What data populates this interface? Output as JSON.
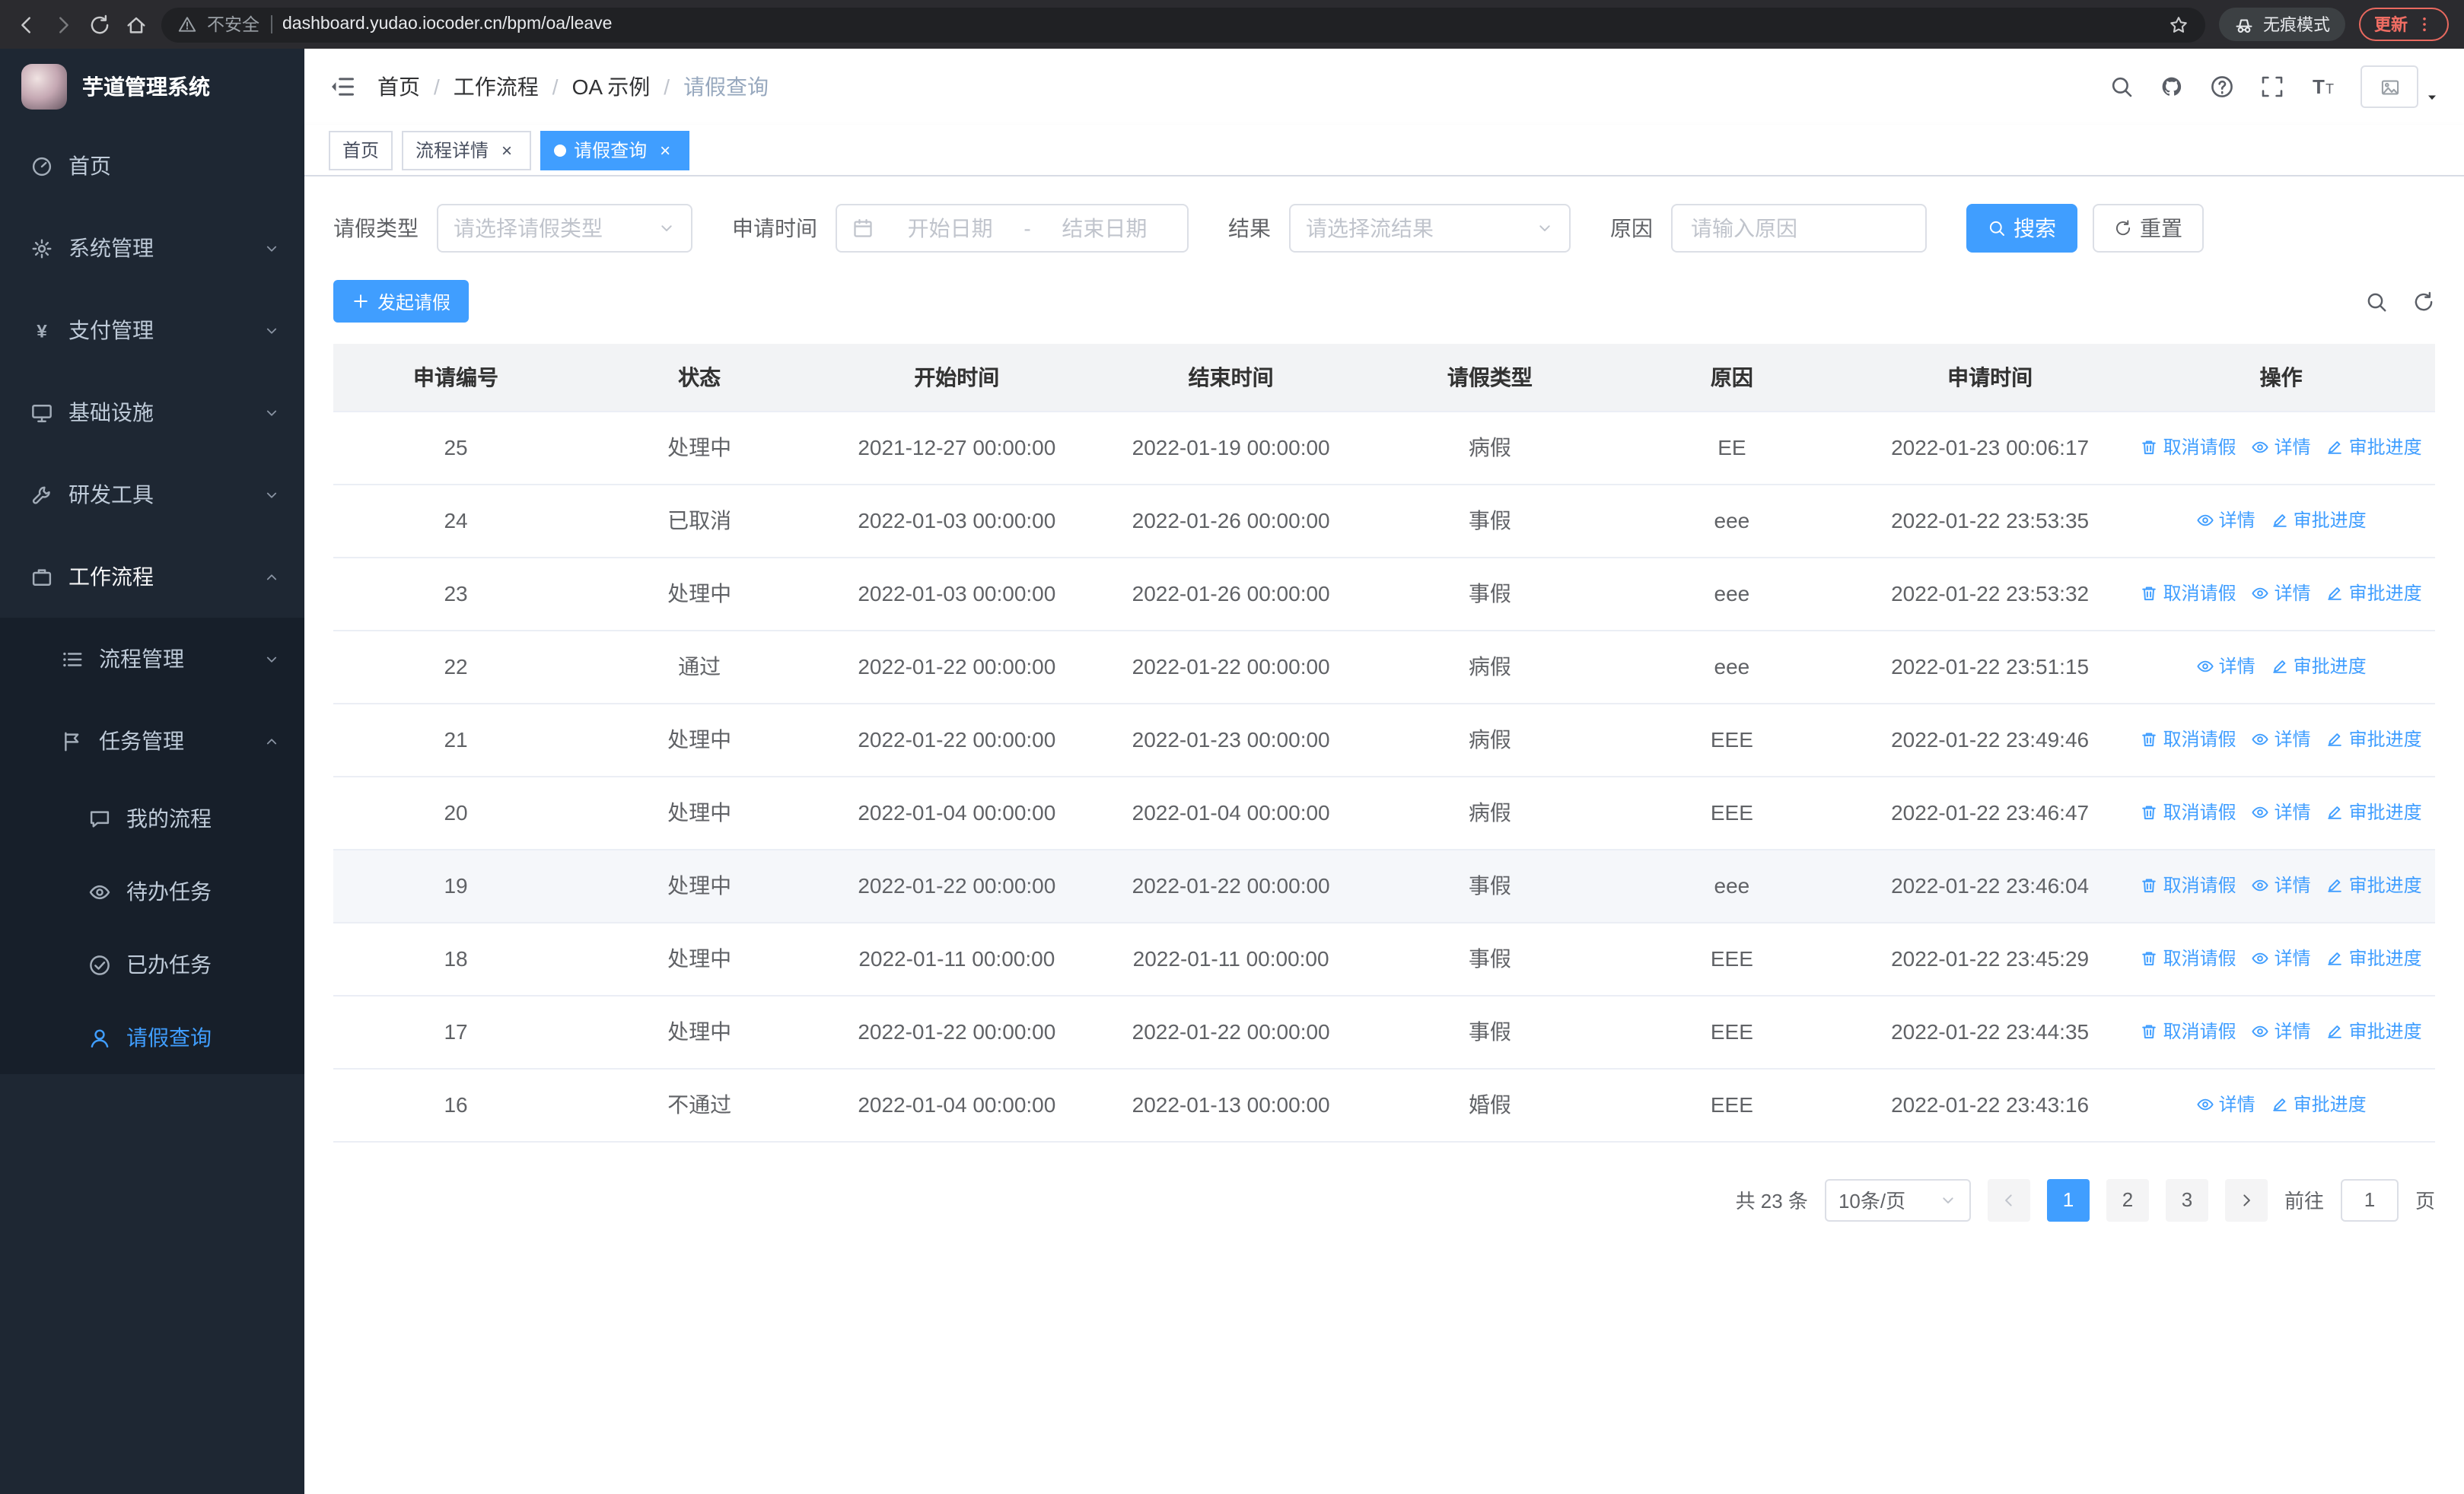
{
  "colors": {
    "primary": "#409eff",
    "sidebar_bg": "#1e2733",
    "sidebar_submenu_bg": "#171f2a",
    "active_tab_bg": "#409eff"
  },
  "browser": {
    "security_label": "不安全",
    "url": "dashboard.yudao.iocoder.cn/bpm/oa/leave",
    "incognito_label": "无痕模式",
    "update_label": "更新"
  },
  "sidebar": {
    "title": "芋道管理系统",
    "menu": [
      {
        "name": "home",
        "label": "首页",
        "icon": "dashboard-icon"
      },
      {
        "name": "system-management",
        "label": "系统管理",
        "icon": "gear-icon",
        "expandable": true
      },
      {
        "name": "payment-management",
        "label": "支付管理",
        "icon": "yen-icon",
        "expandable": true
      },
      {
        "name": "infrastructure",
        "label": "基础设施",
        "icon": "monitor-icon",
        "expandable": true
      },
      {
        "name": "dev-tools",
        "label": "研发工具",
        "icon": "tools-icon",
        "expandable": true
      },
      {
        "name": "workflow",
        "label": "工作流程",
        "icon": "briefcase-icon",
        "expandable": true,
        "expanded": true,
        "children": [
          {
            "name": "process-management",
            "label": "流程管理",
            "icon": "list-icon",
            "expandable": true
          },
          {
            "name": "task-management",
            "label": "任务管理",
            "icon": "flag-icon",
            "expandable": true,
            "expanded": true,
            "children": [
              {
                "name": "my-process",
                "label": "我的流程",
                "icon": "chat-icon"
              },
              {
                "name": "todo-task",
                "label": "待办任务",
                "icon": "eye-icon"
              },
              {
                "name": "done-task",
                "label": "已办任务",
                "icon": "check-icon"
              },
              {
                "name": "leave-query",
                "label": "请假查询",
                "icon": "user-icon",
                "active": true
              }
            ]
          }
        ]
      }
    ]
  },
  "header": {
    "breadcrumb": [
      "首页",
      "工作流程",
      "OA 示例",
      "请假查询"
    ]
  },
  "tabs": [
    {
      "name": "home",
      "label": "首页",
      "closable": false,
      "active": false
    },
    {
      "name": "process-detail",
      "label": "流程详情",
      "closable": true,
      "active": false
    },
    {
      "name": "leave-query",
      "label": "请假查询",
      "closable": true,
      "active": true
    }
  ],
  "filters": {
    "leave_type_label": "请假类型",
    "leave_type_placeholder": "请选择请假类型",
    "apply_time_label": "申请时间",
    "start_date_placeholder": "开始日期",
    "date_separator": "-",
    "end_date_placeholder": "结束日期",
    "result_label": "结果",
    "result_placeholder": "请选择流结果",
    "reason_label": "原因",
    "reason_placeholder": "请输入原因",
    "search_label": "搜索",
    "reset_label": "重置"
  },
  "toolbar": {
    "create_label": "发起请假"
  },
  "table": {
    "columns": [
      {
        "key": "id",
        "label": "申请编号"
      },
      {
        "key": "status",
        "label": "状态"
      },
      {
        "key": "start_time",
        "label": "开始时间"
      },
      {
        "key": "end_time",
        "label": "结束时间"
      },
      {
        "key": "leave_type",
        "label": "请假类型"
      },
      {
        "key": "reason",
        "label": "原因"
      },
      {
        "key": "apply_time",
        "label": "申请时间"
      },
      {
        "key": "actions",
        "label": "操作"
      }
    ],
    "action_defs": {
      "cancel": {
        "label": "取消请假",
        "icon": "delete-icon"
      },
      "detail": {
        "label": "详情",
        "icon": "view-icon"
      },
      "progress": {
        "label": "审批进度",
        "icon": "edit-icon"
      }
    },
    "rows": [
      {
        "id": "25",
        "status": "处理中",
        "start_time": "2021-12-27 00:00:00",
        "end_time": "2022-01-19 00:00:00",
        "leave_type": "病假",
        "reason": "EE",
        "apply_time": "2022-01-23 00:06:17",
        "actions": [
          "cancel",
          "detail",
          "progress"
        ]
      },
      {
        "id": "24",
        "status": "已取消",
        "start_time": "2022-01-03 00:00:00",
        "end_time": "2022-01-26 00:00:00",
        "leave_type": "事假",
        "reason": "eee",
        "apply_time": "2022-01-22 23:53:35",
        "actions": [
          "detail",
          "progress"
        ]
      },
      {
        "id": "23",
        "status": "处理中",
        "start_time": "2022-01-03 00:00:00",
        "end_time": "2022-01-26 00:00:00",
        "leave_type": "事假",
        "reason": "eee",
        "apply_time": "2022-01-22 23:53:32",
        "actions": [
          "cancel",
          "detail",
          "progress"
        ]
      },
      {
        "id": "22",
        "status": "通过",
        "start_time": "2022-01-22 00:00:00",
        "end_time": "2022-01-22 00:00:00",
        "leave_type": "病假",
        "reason": "eee",
        "apply_time": "2022-01-22 23:51:15",
        "actions": [
          "detail",
          "progress"
        ]
      },
      {
        "id": "21",
        "status": "处理中",
        "start_time": "2022-01-22 00:00:00",
        "end_time": "2022-01-23 00:00:00",
        "leave_type": "病假",
        "reason": "EEE",
        "apply_time": "2022-01-22 23:49:46",
        "actions": [
          "cancel",
          "detail",
          "progress"
        ]
      },
      {
        "id": "20",
        "status": "处理中",
        "start_time": "2022-01-04 00:00:00",
        "end_time": "2022-01-04 00:00:00",
        "leave_type": "病假",
        "reason": "EEE",
        "apply_time": "2022-01-22 23:46:47",
        "actions": [
          "cancel",
          "detail",
          "progress"
        ]
      },
      {
        "id": "19",
        "status": "处理中",
        "start_time": "2022-01-22 00:00:00",
        "end_time": "2022-01-22 00:00:00",
        "leave_type": "事假",
        "reason": "eee",
        "apply_time": "2022-01-22 23:46:04",
        "actions": [
          "cancel",
          "detail",
          "progress"
        ],
        "highlighted": true
      },
      {
        "id": "18",
        "status": "处理中",
        "start_time": "2022-01-11 00:00:00",
        "end_time": "2022-01-11 00:00:00",
        "leave_type": "事假",
        "reason": "EEE",
        "apply_time": "2022-01-22 23:45:29",
        "actions": [
          "cancel",
          "detail",
          "progress"
        ]
      },
      {
        "id": "17",
        "status": "处理中",
        "start_time": "2022-01-22 00:00:00",
        "end_time": "2022-01-22 00:00:00",
        "leave_type": "事假",
        "reason": "EEE",
        "apply_time": "2022-01-22 23:44:35",
        "actions": [
          "cancel",
          "detail",
          "progress"
        ]
      },
      {
        "id": "16",
        "status": "不通过",
        "start_time": "2022-01-04 00:00:00",
        "end_time": "2022-01-13 00:00:00",
        "leave_type": "婚假",
        "reason": "EEE",
        "apply_time": "2022-01-22 23:43:16",
        "actions": [
          "detail",
          "progress"
        ]
      }
    ]
  },
  "pagination": {
    "total_text": "共 23 条",
    "page_size": "10条/页",
    "pages": [
      "1",
      "2",
      "3"
    ],
    "active_page": "1",
    "goto_label": "前往",
    "goto_value": "1",
    "page_unit": "页"
  }
}
